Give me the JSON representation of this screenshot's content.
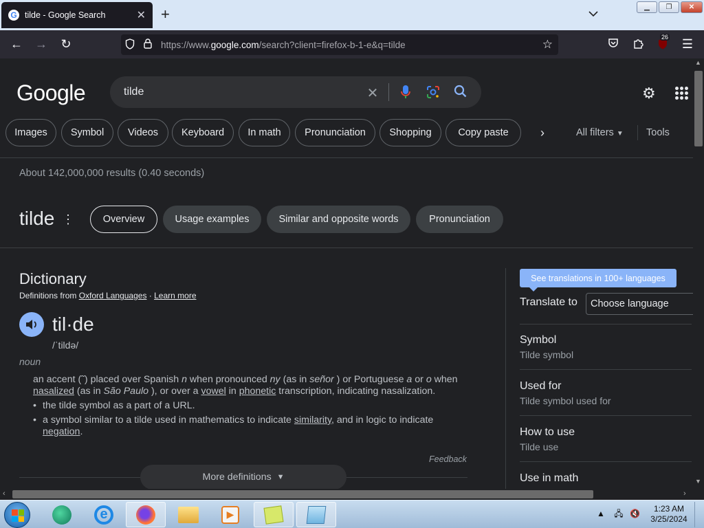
{
  "browser": {
    "tab_title": "tilde - Google Search",
    "tab_close": "✕",
    "new_tab": "+",
    "url_prefix": "https://www.",
    "url_domain": "google.com",
    "url_path": "/search?client=firefox-b-1-e&q=tilde",
    "extension_badge": "26"
  },
  "google": {
    "logo": "Google",
    "query": "tilde",
    "chips": [
      "Images",
      "Symbol",
      "Videos",
      "Keyboard",
      "In math",
      "Pronunciation",
      "Shopping",
      "Copy paste"
    ],
    "all_filters": "All filters",
    "tools": "Tools",
    "stats": "About 142,000,000 results (0.40 seconds)"
  },
  "dictionary_header": {
    "term": "tilde",
    "pills": [
      "Overview",
      "Usage examples",
      "Similar and opposite words",
      "Pronunciation"
    ]
  },
  "dictionary": {
    "title": "Dictionary",
    "source_prefix": "Definitions from ",
    "source_link": "Oxford Languages",
    "source_sep": " · ",
    "learn_more": "Learn more",
    "word": "til·de",
    "phonetic": "/ˈtildə/",
    "pos": "noun",
    "def1_a": "an accent (˜) placed over Spanish ",
    "def1_n": "n",
    "def1_b": " when pronounced ",
    "def1_ny": "ny",
    "def1_c": " (as in ",
    "def1_senor": "señor",
    "def1_d": " ) or Portuguese ",
    "def1_a2": "a",
    "def1_e": " or ",
    "def1_o": "o",
    "def1_f": " when ",
    "def1_nasalized": "nasalized",
    "def1_g": " (as in ",
    "def1_sao": "São Paulo",
    "def1_h": " ), or over a ",
    "def1_vowel": "vowel",
    "def1_i": " in ",
    "def1_phonetic": "phonetic",
    "def1_j": " transcription, indicating nasalization.",
    "def2": "the tilde symbol as a part of a URL.",
    "def3_a": "a symbol similar to a tilde used in mathematics to indicate ",
    "def3_similarity": "similarity",
    "def3_b": ", and in logic to indicate ",
    "def3_negation": "negation",
    "def3_c": ".",
    "feedback": "Feedback",
    "more": "More definitions"
  },
  "side": {
    "tooltip": "See translations in 100+ languages",
    "translate_to": "Translate to",
    "choose_language": "Choose language",
    "items": [
      {
        "title": "Symbol",
        "sub": "Tilde symbol"
      },
      {
        "title": "Used for",
        "sub": "Tilde symbol used for"
      },
      {
        "title": "How to use",
        "sub": "Tilde use"
      },
      {
        "title": "Use in math",
        "sub": ""
      }
    ]
  },
  "taskbar": {
    "time": "1:23 AM",
    "date": "3/25/2024"
  },
  "colors": {
    "background": "#202124",
    "accent": "#8ab4f8"
  }
}
